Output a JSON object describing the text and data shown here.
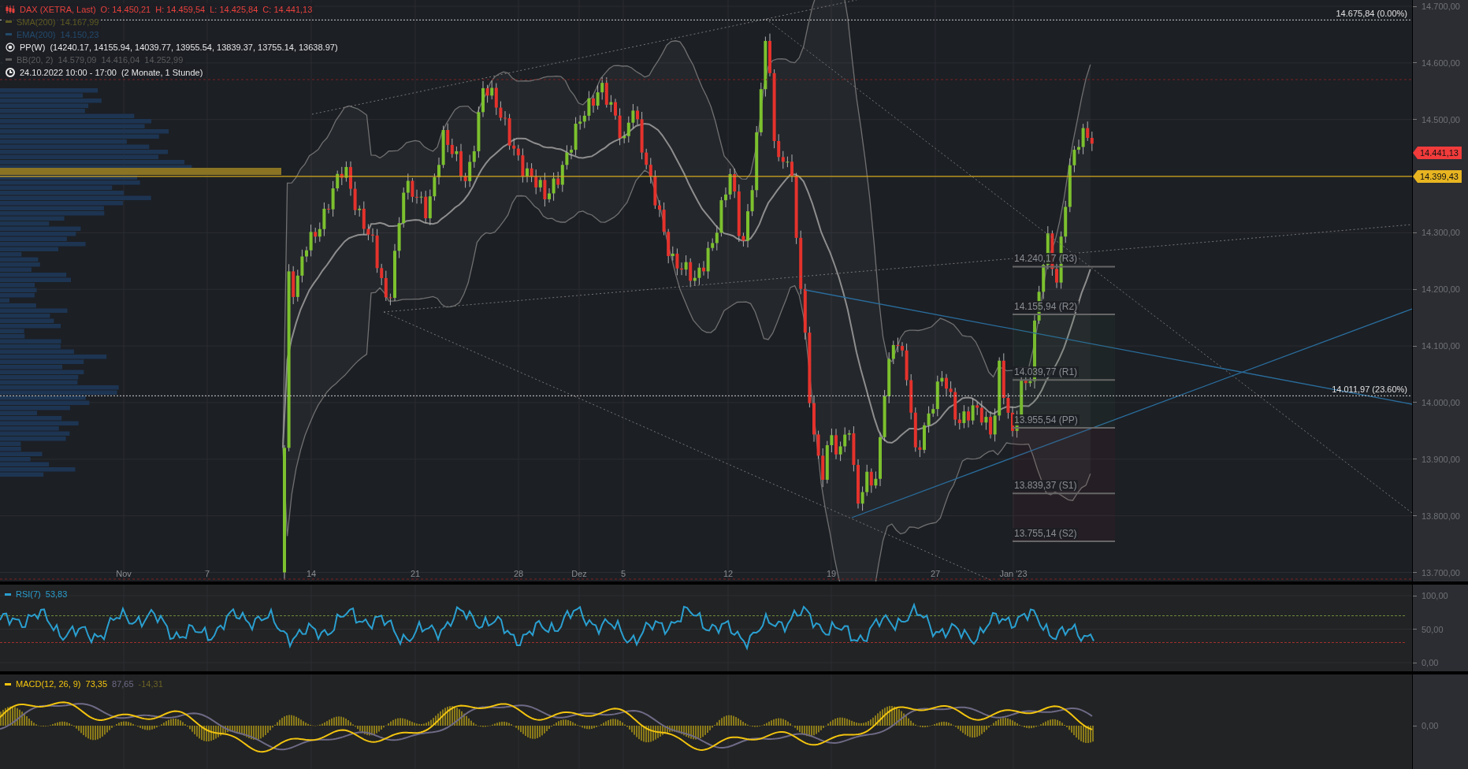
{
  "legend": [
    {
      "kind": "instrument",
      "label": "DAX (XETRA, Last)",
      "color": "#e8413c",
      "values": [
        "O: 14.450,21",
        "H: 14.459,54",
        "L: 14.425,84",
        "C: 14.441,13"
      ]
    },
    {
      "kind": "line",
      "label": "SMA(200)",
      "color": "#5e5a22",
      "values": [
        "14.167,99"
      ]
    },
    {
      "kind": "line",
      "label": "EMA(200)",
      "color": "#234a6b",
      "values": [
        "14.150,23"
      ]
    },
    {
      "kind": "pivot",
      "label": "PP(W)",
      "color": "#e6e6e6",
      "values": [
        "(14240.17, 14155.94, 14039.77, 13955.54, 13839.37, 13755.14, 13638.97)"
      ]
    },
    {
      "kind": "line",
      "label": "BB(20, 2)",
      "color": "#5c5c5c",
      "values": [
        "14.579,09",
        "14.416,04",
        "14.252,99"
      ]
    },
    {
      "kind": "time",
      "label": "24.10.2022 10:00 - 17:00",
      "color": "#e6e6e6",
      "values": [
        "(2 Monate, 1 Stunde)"
      ]
    }
  ],
  "fib_levels": [
    "14.675,84 (0.00%)",
    "14.011,97 (23.60%)"
  ],
  "pivot_labels": [
    "14.240,17 (R3)",
    "14.155,94 (R2)",
    "14.039,77 (R1)",
    "13.955,54 (PP)",
    "13.839,37 (S1)",
    "13.755,14 (S2)"
  ],
  "time_axis": [
    "Nov",
    "7",
    "14",
    "21",
    "28",
    "Dez",
    "5",
    "12",
    "19",
    "27",
    "Jan '23"
  ],
  "price_axis": {
    "ticks": [
      "14.700,00",
      "14.600,00",
      "14.500,00",
      "14.300,00",
      "14.200,00",
      "14.100,00",
      "14.000,00",
      "13.900,00",
      "13.800,00",
      "13.700,00"
    ],
    "tags": [
      {
        "text": "14.441,13",
        "color": "#f23b3b"
      },
      {
        "text": "14.399,43",
        "color": "#e8b521"
      }
    ]
  },
  "rsi": {
    "label": "RSI(7)",
    "color": "#2a9fd0",
    "values": [
      {
        "text": "53,83",
        "color": "#2a9fd0"
      }
    ],
    "ticks": [
      "100,00",
      "50,00",
      "0,00"
    ]
  },
  "macd": {
    "label": "MACD(12, 26, 9)",
    "color": "#f2c40f",
    "values": [
      {
        "text": "73,35",
        "color": "#f2c40f"
      },
      {
        "text": "87,65",
        "color": "#6e6a86"
      },
      {
        "text": "-14,31",
        "color": "#6b6326"
      }
    ],
    "ticks": [
      "0,00"
    ]
  }
}
